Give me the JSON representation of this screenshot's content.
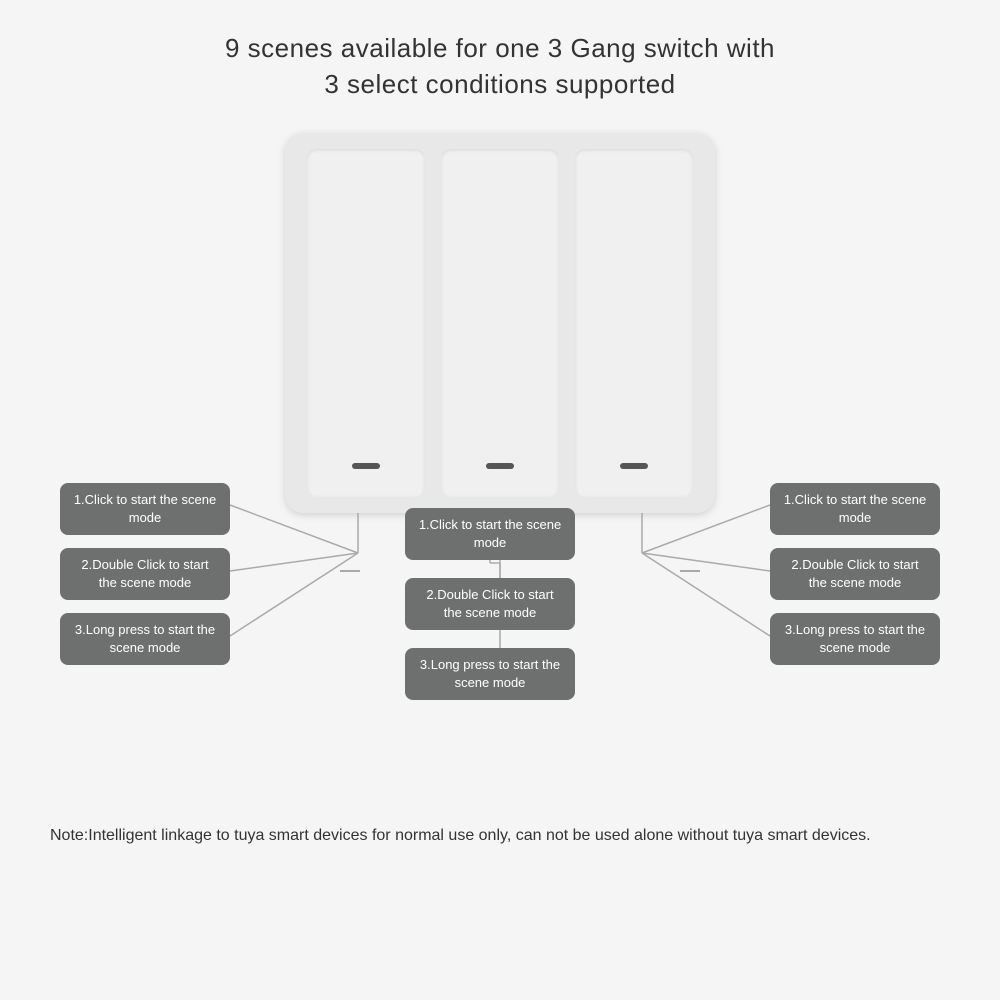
{
  "title": {
    "line1": "9 scenes available for one 3 Gang switch with",
    "line2": "3 select conditions supported"
  },
  "switch": {
    "buttons": [
      {
        "id": "left-button"
      },
      {
        "id": "center-button"
      },
      {
        "id": "right-button"
      }
    ]
  },
  "labels": {
    "left": [
      {
        "text": "1.Click to start\nthe scene mode"
      },
      {
        "text": "2.Double Click to\nstart the scene mode"
      },
      {
        "text": "3.Long press to\nstart the scene mode"
      }
    ],
    "center": [
      {
        "text": "1.Click to start\nthe scene mode"
      },
      {
        "text": "2.Double Click to\nstart the scene mode"
      },
      {
        "text": "3.Long press to\nstart the scene mode"
      }
    ],
    "right": [
      {
        "text": "1.Click to start\nthe scene mode"
      },
      {
        "text": "2.Double Click to\nstart the scene mode"
      },
      {
        "text": "3.Long press to\nstart the scene mode"
      }
    ]
  },
  "note": {
    "text": "Note:Intelligent linkage to tuya smart devices for normal use only,\ncan not be used alone without tuya smart devices."
  },
  "colors": {
    "label_bg": "#6e7070",
    "label_text": "#ffffff",
    "switch_bg": "#e8e8e8",
    "button_bg": "#f0f0f0",
    "indicator": "#555555",
    "line_color": "#9e9e9e"
  }
}
